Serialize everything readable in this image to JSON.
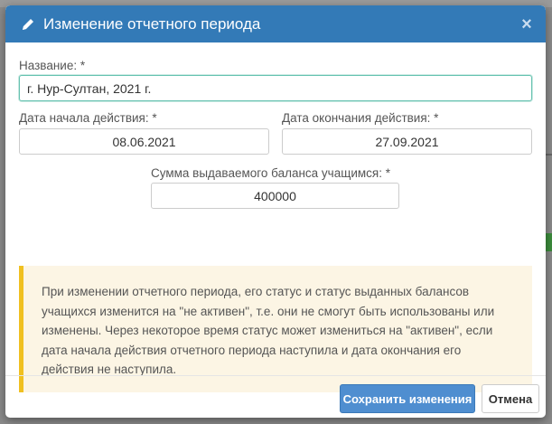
{
  "dialog": {
    "title": "Изменение отчетного периода",
    "close_glyph": "×",
    "icon": "pencil-icon",
    "accent_color": "#337ab7"
  },
  "form": {
    "name": {
      "label": "Название: *",
      "value": "г. Нур-Султан, 2021 г."
    },
    "start_date": {
      "label": "Дата начала действия: *",
      "value": "08.06.2021"
    },
    "end_date": {
      "label": "Дата окончания действия: *",
      "value": "27.09.2021"
    },
    "balance": {
      "label": "Сумма выдаваемого баланса учащимся: *",
      "value": "400000"
    }
  },
  "alert": {
    "text": "При изменении отчетного периода, его статус и статус выданных балансов учащихся изменится на \"не активен\", т.е. они не смогут быть использованы или изменены. Через некоторое время статус может измениться на \"активен\", если дата начала действия отчетного периода наступила и дата окончания его действия не наступила.",
    "border_color": "#f0c020",
    "background_color": "#fcf5e4"
  },
  "footer": {
    "save_label": "Сохранить изменения",
    "cancel_label": "Отмена"
  }
}
